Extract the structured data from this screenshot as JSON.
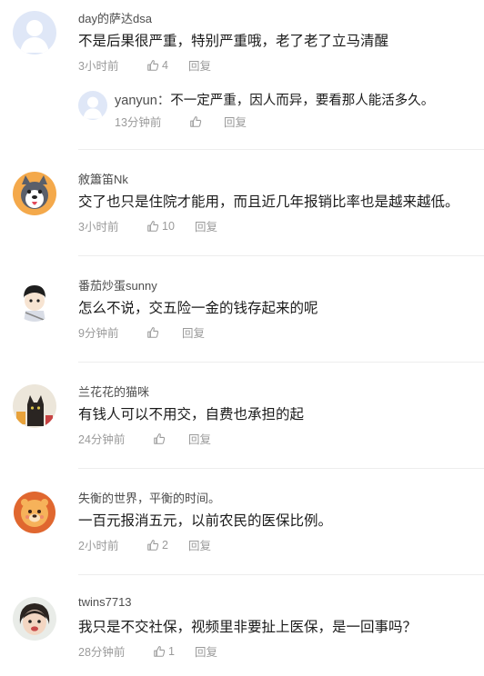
{
  "comments": [
    {
      "username": "day的萨达dsa",
      "avatar": "default-avatar-icon",
      "text": "不是后果很严重，特别严重哦，老了老了立马清醒",
      "time": "3小时前",
      "likes": "4",
      "reply_label": "回复",
      "sub_reply": {
        "username": "yanyun",
        "separator": "：",
        "text": "不一定严重，因人而异，要看那人能活多久。",
        "time": "13分钟前",
        "likes": "",
        "reply_label": "回复",
        "avatar": "default-avatar-icon"
      }
    },
    {
      "username": "敘簫笛Nk",
      "avatar": "husky-avatar",
      "text": "交了也只是住院才能用，而且近几年报销比率也是越来越低。",
      "time": "3小时前",
      "likes": "10",
      "reply_label": "回复"
    },
    {
      "username": "番茄炒蛋sunny",
      "avatar": "cartoon-boy-avatar",
      "text": "怎么不说，交五险一金的钱存起来的呢",
      "time": "9分钟前",
      "likes": "",
      "reply_label": "回复"
    },
    {
      "username": "兰花花的猫咪",
      "avatar": "black-cat-avatar",
      "text": "有钱人可以不用交，自费也承担的起",
      "time": "24分钟前",
      "likes": "",
      "reply_label": "回复"
    },
    {
      "username": "失衡的世界，平衡的时间。",
      "avatar": "lion-avatar",
      "text": "一百元报消五元，以前农民的医保比例。",
      "time": "2小时前",
      "likes": "2",
      "reply_label": "回复"
    },
    {
      "username": "twins7713",
      "avatar": "child-photo-avatar",
      "text": "我只是不交社保，视频里非要扯上医保，是一回事吗？",
      "time": "28分钟前",
      "likes": "1",
      "reply_label": "回复"
    }
  ],
  "colors": {
    "text_primary": "#1a1a1a",
    "text_secondary": "#4d4d4d",
    "meta": "#9a9a9a",
    "divider": "#ededed",
    "default_avatar_bg": "#dfe7f7"
  }
}
